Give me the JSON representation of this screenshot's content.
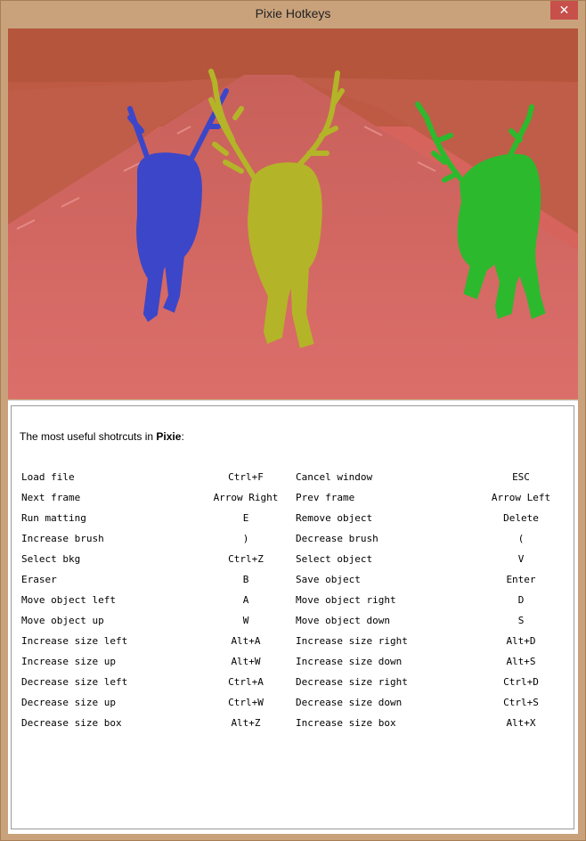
{
  "window": {
    "title": "Pixie Hotkeys",
    "close_label": "✕"
  },
  "intro": {
    "prefix": "The most useful shotrcuts in ",
    "app": "Pixie",
    "suffix": ":"
  },
  "shortcuts": [
    {
      "action1": "Load file",
      "key1": "Ctrl+F",
      "action2": "Cancel window",
      "key2": "ESC"
    },
    {
      "action1": "Next frame",
      "key1": "Arrow Right",
      "action2": "Prev frame",
      "key2": "Arrow Left"
    },
    {
      "action1": "Run matting",
      "key1": "E",
      "action2": "Remove object",
      "key2": "Delete"
    },
    {
      "action1": "Increase brush",
      "key1": ")",
      "action2": "Decrease brush",
      "key2": "("
    },
    {
      "action1": "Select bkg",
      "key1": "Ctrl+Z",
      "action2": "Select object",
      "key2": "V"
    },
    {
      "action1": "Eraser",
      "key1": "B",
      "action2": "Save object",
      "key2": "Enter"
    },
    {
      "action1": "Move object left",
      "key1": "A",
      "action2": "Move object right",
      "key2": "D"
    },
    {
      "action1": "Move object up",
      "key1": "W",
      "action2": "Move object down",
      "key2": "S"
    },
    {
      "action1": "Increase size left",
      "key1": "Alt+A",
      "action2": "Increase size right",
      "key2": "Alt+D"
    },
    {
      "action1": "Increase size up",
      "key1": "Alt+W",
      "action2": "Increase size down",
      "key2": "Alt+S"
    },
    {
      "action1": "Decrease size left",
      "key1": "Ctrl+A",
      "action2": "Decrease size right",
      "key2": "Ctrl+D"
    },
    {
      "action1": "Decrease size up",
      "key1": "Ctrl+W",
      "action2": "Decrease size down",
      "key2": "Ctrl+S"
    },
    {
      "action1": "Decrease size box",
      "key1": "Alt+Z",
      "action2": "Increase size box",
      "key2": "Alt+X"
    }
  ],
  "colors": {
    "frame": "#c9a27c",
    "close_button": "#c7504b",
    "background_mask": "#d9635f",
    "object_blue": "#3c46c8",
    "object_yellow": "#b4b428",
    "object_green": "#2db92d"
  }
}
